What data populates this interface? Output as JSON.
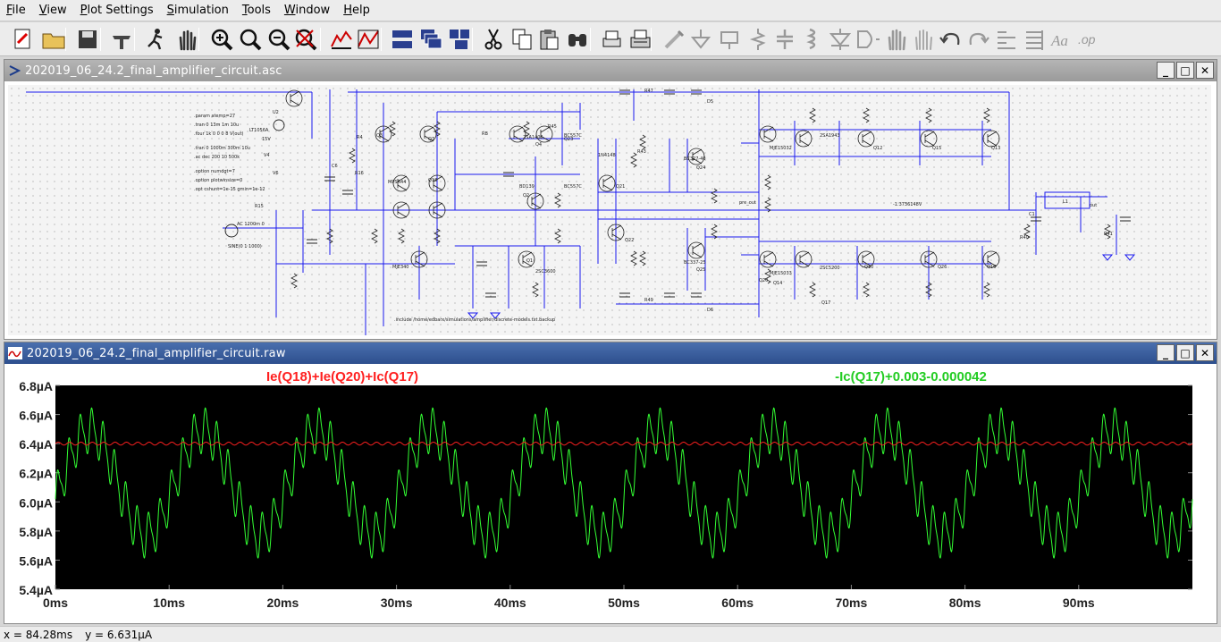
{
  "menu": [
    "File",
    "View",
    "Plot Settings",
    "Simulation",
    "Tools",
    "Window",
    "Help"
  ],
  "menu_underline": [
    "F",
    "V",
    "P",
    "S",
    "T",
    "W",
    "H"
  ],
  "schematic": {
    "title": "202019_06_24.2_final_amplifier_circuit.asc",
    "directives": [
      ".param atemp=27",
      ".tran 0 13m 1m 10u",
      ".four 1k 0 0 0 8 V(out)",
      ".tran 0 1000m 300m 10u",
      ".ac dec 200 10 500k",
      ".option numdgt=7",
      ".option plotwinsize=0",
      ".opt cshunt=1e-15 gmin=1e-12"
    ],
    "include": ".include /home/edbarx/simulations/amplifier/discrete-models.txt.backup",
    "labels": [
      "U2",
      "LT1056A",
      "15V",
      "V4",
      "V6",
      "R15",
      "C6",
      "R16",
      "Q3",
      "Q7",
      "Q4",
      "Q2",
      "Q1",
      "MJE340",
      "2SC3600",
      "2SA1406",
      "BC327-40",
      "BC337-25",
      "BC557C",
      "MJE15032",
      "MJE15033",
      "2SA1943",
      "2SC5200",
      "MPSA44",
      "BD139",
      "BC557C",
      "L1",
      "C1",
      "R41",
      "R40",
      "out",
      "pre_out",
      "SINE(0 1 1000)",
      "AC 1200m 0",
      "1N4148",
      "RB",
      "R4",
      "R43",
      "R45",
      "R47",
      "R49",
      "D5",
      "D6",
      "Q10",
      "Q12",
      "Q13",
      "Q14",
      "Q15",
      "Q16",
      "Q17",
      "Q18",
      "Q20",
      "Q21",
      "Q22",
      "Q23",
      "Q24",
      "Q25",
      "Q26",
      "-1.3736148V"
    ]
  },
  "plot": {
    "title": "202019_06_24.2_final_amplifier_circuit.raw",
    "trace_red_label": "Ie(Q18)+Ie(Q20)+Ic(Q17)",
    "trace_green_label": "-Ic(Q17)+0.003-0.000042",
    "red_color": "#ff2020",
    "green_color": "#33ff33",
    "background_color": "#000000"
  },
  "chart_data": {
    "type": "line",
    "title": "",
    "xlabel": "",
    "ylabel": "",
    "x_unit": "ms",
    "y_unit": "µA",
    "xlim": [
      0,
      100
    ],
    "ylim": [
      5.4,
      6.8
    ],
    "x_ticks": [
      "0ms",
      "10ms",
      "20ms",
      "30ms",
      "40ms",
      "50ms",
      "60ms",
      "70ms",
      "80ms",
      "90ms"
    ],
    "y_ticks": [
      "6.8µA",
      "6.6µA",
      "6.4µA",
      "6.2µA",
      "6.0µA",
      "5.8µA",
      "5.6µA",
      "5.4µA"
    ],
    "series": [
      {
        "name": "Ie(Q18)+Ie(Q20)+Ic(Q17)",
        "color": "#ff2020",
        "mean": 6.4,
        "ripple": 0.01,
        "period_ms": 1
      },
      {
        "name": "-Ic(Q17)+0.003-0.000042",
        "color": "#33ff33",
        "mean": 6.13,
        "amplitude": 0.36,
        "period_ms": 10,
        "ripple": 0.14,
        "ripple_period_ms": 1,
        "max": 6.84,
        "min": 5.45
      }
    ]
  },
  "status": {
    "x": "x = 84.28ms",
    "y": "y = 6.631µA"
  }
}
